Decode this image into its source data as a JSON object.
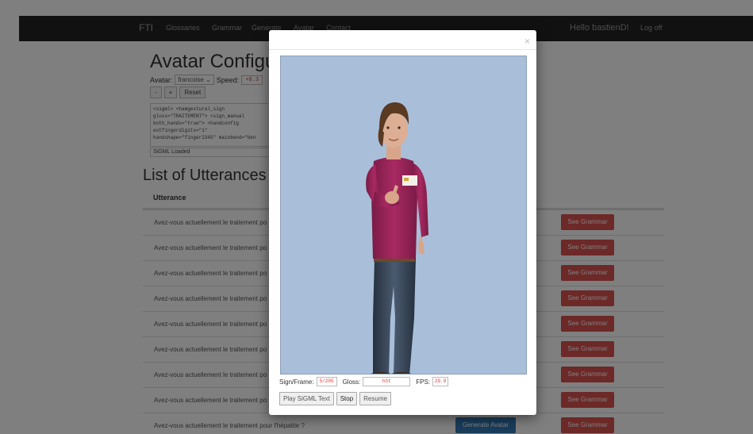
{
  "navbar": {
    "brand": "FTI",
    "links": [
      "Glossaries",
      "Grammar",
      "Generate",
      "Avatar",
      "Contact"
    ],
    "greeting": "Hello bastienD!",
    "logoff": "Log off"
  },
  "config": {
    "title": "Avatar Configura",
    "avatar_label": "Avatar:",
    "avatar_value": "francoise",
    "speed_label": "Speed:",
    "speed_value": "+0.3",
    "minus_label": "-",
    "plus_label": "+",
    "reset_label": "Reset",
    "sigml_text": "<sigml> <hamgestural_sign\ngloss=\"TRAITEMENT\"> <sign_manual\nboth_hands=\"true\"> <handconfig\nextfingerdigits=\"1\"\nhandshape=\"finger2345\" mainbend=\"ben",
    "sigml_status": "SiGML Loaded"
  },
  "utterances": {
    "title": "List of Utterances",
    "column_header": "Utterance",
    "see_grammar_label": "See Grammar",
    "generate_label": "Generate Avatar",
    "rows": [
      "Avez-vous actuellement le traitement po",
      "Avez-vous actuellement le traitement po",
      "Avez-vous actuellement le traitement po",
      "Avez-vous actuellement le traitement po",
      "Avez-vous actuellement le traitement po",
      "Avez-vous actuellement le traitement po",
      "Avez-vous actuellement le traitement po",
      "Avez-vous actuellement le traitement po",
      "Avez-vous actuellement le traitement pour l'hépatite ?"
    ]
  },
  "modal": {
    "close_glyph": "×",
    "sign_frame_label": "Sign/Frame:",
    "sign_frame_value": "5/205",
    "gloss_label": "Gloss:",
    "gloss_value": "hôt",
    "fps_label": "FPS:",
    "fps_value": "29.9",
    "play_label": "Play SiGML Text",
    "stop_label": "Stop",
    "resume_label": "Resume"
  },
  "colors": {
    "navbar": "#222222",
    "danger": "#d9534f",
    "primary": "#337ab7",
    "canvas": "#a9bfd9"
  }
}
